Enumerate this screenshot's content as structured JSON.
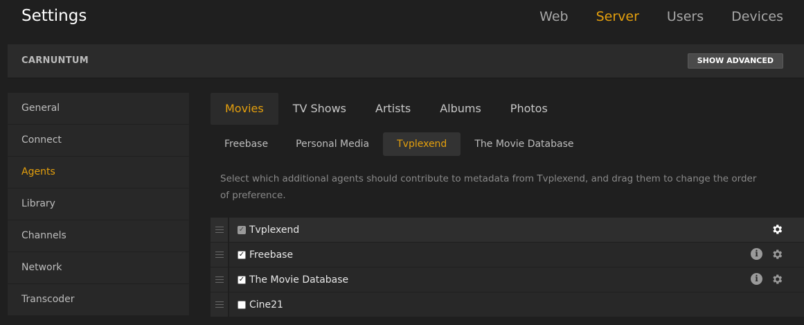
{
  "app": {
    "title": "Settings"
  },
  "topnav": [
    {
      "label": "Web",
      "active": false
    },
    {
      "label": "Server",
      "active": true
    },
    {
      "label": "Users",
      "active": false
    },
    {
      "label": "Devices",
      "active": false
    }
  ],
  "server": {
    "name": "CARNUNTUM",
    "show_advanced_label": "SHOW ADVANCED"
  },
  "sidebar": {
    "items": [
      {
        "label": "General",
        "active": false
      },
      {
        "label": "Connect",
        "active": false
      },
      {
        "label": "Agents",
        "active": true
      },
      {
        "label": "Library",
        "active": false
      },
      {
        "label": "Channels",
        "active": false
      },
      {
        "label": "Network",
        "active": false
      },
      {
        "label": "Transcoder",
        "active": false
      }
    ]
  },
  "tabs": [
    {
      "label": "Movies",
      "active": true
    },
    {
      "label": "TV Shows",
      "active": false
    },
    {
      "label": "Artists",
      "active": false
    },
    {
      "label": "Albums",
      "active": false
    },
    {
      "label": "Photos",
      "active": false
    }
  ],
  "subtabs": [
    {
      "label": "Freebase",
      "active": false
    },
    {
      "label": "Personal Media",
      "active": false
    },
    {
      "label": "Tvplexend",
      "active": true
    },
    {
      "label": "The Movie Database",
      "active": false
    }
  ],
  "description": "Select which additional agents should contribute to metadata from Tvplexend, and drag them to change the order of preference.",
  "agents": [
    {
      "name": "Tvplexend",
      "checked": true,
      "disabled": true,
      "has_info": false,
      "has_settings": true
    },
    {
      "name": "Freebase",
      "checked": true,
      "disabled": false,
      "has_info": true,
      "has_settings": true
    },
    {
      "name": "The Movie Database",
      "checked": true,
      "disabled": false,
      "has_info": true,
      "has_settings": true
    },
    {
      "name": "Cine21",
      "checked": false,
      "disabled": false,
      "has_info": false,
      "has_settings": false
    }
  ],
  "icons": {
    "drag": "drag-handle-icon",
    "info": "info-icon",
    "settings": "gear-icon",
    "info_glyph": "i"
  },
  "colors": {
    "accent": "#e5a00d",
    "background": "#1f1f1f",
    "panel": "#2b2b2b"
  }
}
